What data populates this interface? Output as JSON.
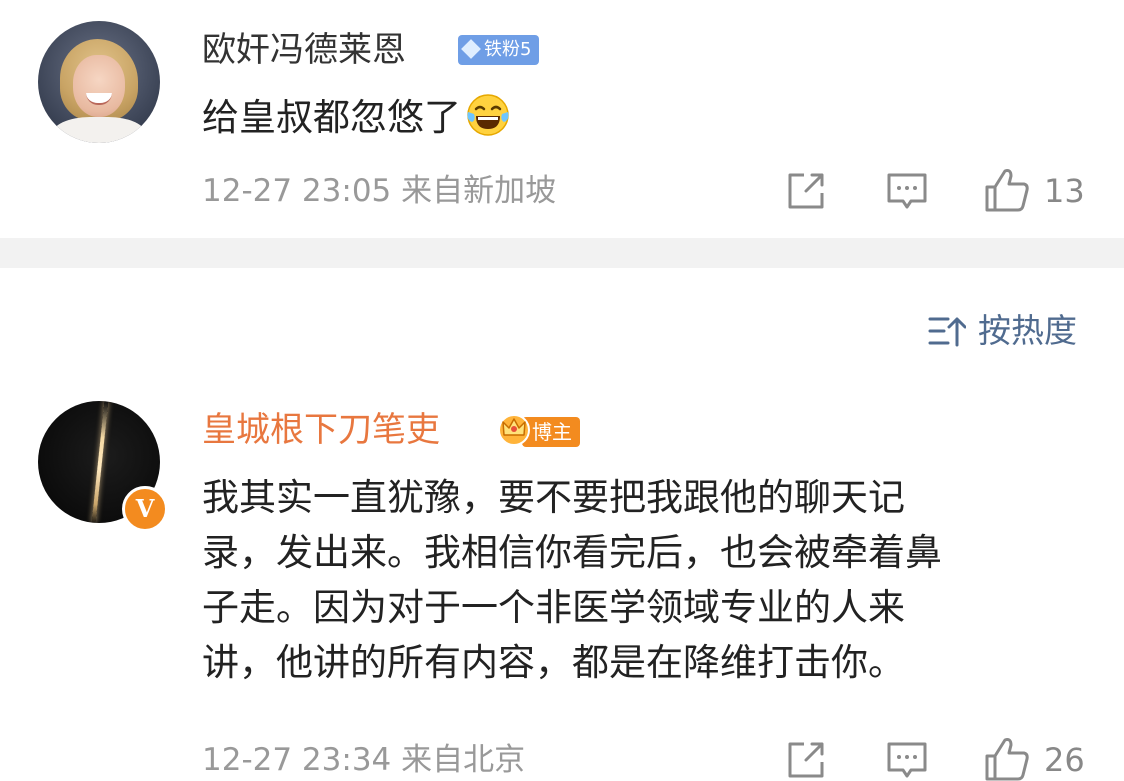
{
  "comments": [
    {
      "username": "欧奸冯德莱恩",
      "badge": "铁粉5",
      "text": "给皇叔都忽悠了",
      "emoji": "laughing-tears-emoji",
      "timestamp": "12-27 23:05",
      "location": "来自新加坡",
      "likes": "13"
    },
    {
      "username": "皇城根下刀笔吏",
      "badge": "博主",
      "verified_mark": "V",
      "text_lines": [
        "我其实一直犹豫，要不要把我跟他的聊天记",
        "录，发出来。我相信你看完后，也会被牵着鼻",
        "子走。因为对于一个非医学领域专业的人来",
        "讲，他讲的所有内容，都是在降维打击你。"
      ],
      "timestamp": "12-27 23:34",
      "location": "来自北京",
      "likes": "26"
    }
  ],
  "sort": {
    "label": "按热度",
    "icon": "sort-by-heat-icon"
  },
  "icons": {
    "share": "share-icon",
    "reply": "comment-icon",
    "like": "thumbs-up-icon"
  },
  "colors": {
    "username_vip": "#e8773f",
    "fan_badge": "#6f9ee6",
    "blogger_badge": "#f38b1f",
    "meta_gray": "#999999",
    "sort_blue": "#506b8f"
  }
}
